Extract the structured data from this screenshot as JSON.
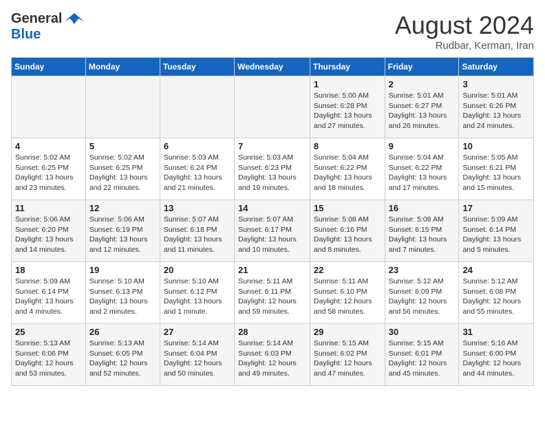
{
  "header": {
    "logo_general": "General",
    "logo_blue": "Blue",
    "title": "August 2024",
    "subtitle": "Rudbar, Kerman, Iran"
  },
  "weekdays": [
    "Sunday",
    "Monday",
    "Tuesday",
    "Wednesday",
    "Thursday",
    "Friday",
    "Saturday"
  ],
  "weeks": [
    [
      {
        "day": "",
        "info": ""
      },
      {
        "day": "",
        "info": ""
      },
      {
        "day": "",
        "info": ""
      },
      {
        "day": "",
        "info": ""
      },
      {
        "day": "1",
        "info": "Sunrise: 5:00 AM\nSunset: 6:28 PM\nDaylight: 13 hours and 27 minutes."
      },
      {
        "day": "2",
        "info": "Sunrise: 5:01 AM\nSunset: 6:27 PM\nDaylight: 13 hours and 26 minutes."
      },
      {
        "day": "3",
        "info": "Sunrise: 5:01 AM\nSunset: 6:26 PM\nDaylight: 13 hours and 24 minutes."
      }
    ],
    [
      {
        "day": "4",
        "info": "Sunrise: 5:02 AM\nSunset: 6:25 PM\nDaylight: 13 hours and 23 minutes."
      },
      {
        "day": "5",
        "info": "Sunrise: 5:02 AM\nSunset: 6:25 PM\nDaylight: 13 hours and 22 minutes."
      },
      {
        "day": "6",
        "info": "Sunrise: 5:03 AM\nSunset: 6:24 PM\nDaylight: 13 hours and 21 minutes."
      },
      {
        "day": "7",
        "info": "Sunrise: 5:03 AM\nSunset: 6:23 PM\nDaylight: 13 hours and 19 minutes."
      },
      {
        "day": "8",
        "info": "Sunrise: 5:04 AM\nSunset: 6:22 PM\nDaylight: 13 hours and 18 minutes."
      },
      {
        "day": "9",
        "info": "Sunrise: 5:04 AM\nSunset: 6:22 PM\nDaylight: 13 hours and 17 minutes."
      },
      {
        "day": "10",
        "info": "Sunrise: 5:05 AM\nSunset: 6:21 PM\nDaylight: 13 hours and 15 minutes."
      }
    ],
    [
      {
        "day": "11",
        "info": "Sunrise: 5:06 AM\nSunset: 6:20 PM\nDaylight: 13 hours and 14 minutes."
      },
      {
        "day": "12",
        "info": "Sunrise: 5:06 AM\nSunset: 6:19 PM\nDaylight: 13 hours and 12 minutes."
      },
      {
        "day": "13",
        "info": "Sunrise: 5:07 AM\nSunset: 6:18 PM\nDaylight: 13 hours and 11 minutes."
      },
      {
        "day": "14",
        "info": "Sunrise: 5:07 AM\nSunset: 6:17 PM\nDaylight: 13 hours and 10 minutes."
      },
      {
        "day": "15",
        "info": "Sunrise: 5:08 AM\nSunset: 6:16 PM\nDaylight: 13 hours and 8 minutes."
      },
      {
        "day": "16",
        "info": "Sunrise: 5:08 AM\nSunset: 6:15 PM\nDaylight: 13 hours and 7 minutes."
      },
      {
        "day": "17",
        "info": "Sunrise: 5:09 AM\nSunset: 6:14 PM\nDaylight: 13 hours and 5 minutes."
      }
    ],
    [
      {
        "day": "18",
        "info": "Sunrise: 5:09 AM\nSunset: 6:14 PM\nDaylight: 13 hours and 4 minutes."
      },
      {
        "day": "19",
        "info": "Sunrise: 5:10 AM\nSunset: 6:13 PM\nDaylight: 13 hours and 2 minutes."
      },
      {
        "day": "20",
        "info": "Sunrise: 5:10 AM\nSunset: 6:12 PM\nDaylight: 13 hours and 1 minute."
      },
      {
        "day": "21",
        "info": "Sunrise: 5:11 AM\nSunset: 6:11 PM\nDaylight: 12 hours and 59 minutes."
      },
      {
        "day": "22",
        "info": "Sunrise: 5:11 AM\nSunset: 6:10 PM\nDaylight: 12 hours and 58 minutes."
      },
      {
        "day": "23",
        "info": "Sunrise: 5:12 AM\nSunset: 6:09 PM\nDaylight: 12 hours and 56 minutes."
      },
      {
        "day": "24",
        "info": "Sunrise: 5:12 AM\nSunset: 6:08 PM\nDaylight: 12 hours and 55 minutes."
      }
    ],
    [
      {
        "day": "25",
        "info": "Sunrise: 5:13 AM\nSunset: 6:06 PM\nDaylight: 12 hours and 53 minutes."
      },
      {
        "day": "26",
        "info": "Sunrise: 5:13 AM\nSunset: 6:05 PM\nDaylight: 12 hours and 52 minutes."
      },
      {
        "day": "27",
        "info": "Sunrise: 5:14 AM\nSunset: 6:04 PM\nDaylight: 12 hours and 50 minutes."
      },
      {
        "day": "28",
        "info": "Sunrise: 5:14 AM\nSunset: 6:03 PM\nDaylight: 12 hours and 49 minutes."
      },
      {
        "day": "29",
        "info": "Sunrise: 5:15 AM\nSunset: 6:02 PM\nDaylight: 12 hours and 47 minutes."
      },
      {
        "day": "30",
        "info": "Sunrise: 5:15 AM\nSunset: 6:01 PM\nDaylight: 12 hours and 45 minutes."
      },
      {
        "day": "31",
        "info": "Sunrise: 5:16 AM\nSunset: 6:00 PM\nDaylight: 12 hours and 44 minutes."
      }
    ]
  ]
}
